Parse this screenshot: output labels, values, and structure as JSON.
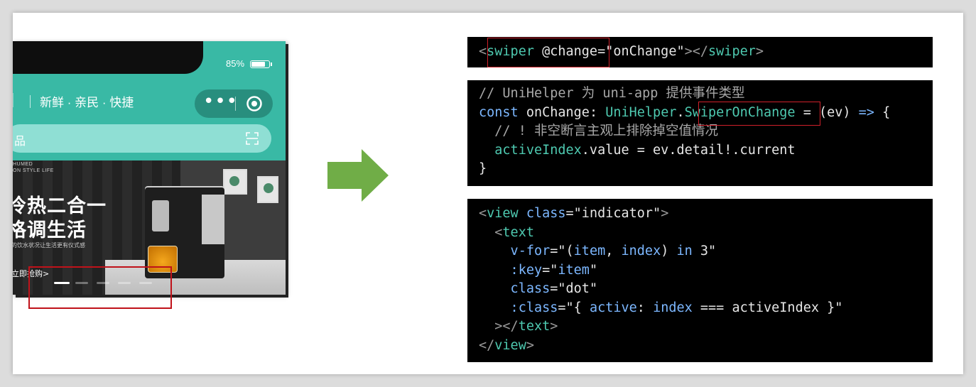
{
  "phone": {
    "battery_percent": "85%",
    "battery_level": 0.85,
    "logo_fragment": "l",
    "tagline": "新鲜 · 亲民 · 快捷",
    "menu_dots": "•••",
    "search_fragment": "品",
    "banner": {
      "brand_line1": "HUMED",
      "brand_line2": "ON STYLE LIFE",
      "headline1": "冷热二合一",
      "headline2": "格调生活",
      "small_line": "的饮水状况让生活更有仪式感",
      "buy_link": "立即抢购>"
    },
    "indicators": {
      "count": 5,
      "active_index": 0
    }
  },
  "code_blocks": {
    "block1": {
      "tokens": [
        "<",
        "swiper",
        " @change",
        "=",
        "\"onChange\"",
        "></",
        "swiper",
        ">"
      ]
    },
    "block2": {
      "line1": "// UniHelper 为 uni-app 提供事件类型",
      "line2_tokens": [
        "const",
        " onChange",
        ": ",
        "UniHelper",
        ".",
        "SwiperOnChange",
        " = (ev) ",
        "=>",
        " {"
      ],
      "line3": "  // ! 非空断言主观上排除掉空值情况",
      "line4_tokens": [
        "  activeIndex",
        ".value = ev.detail!.current"
      ],
      "line5": "}"
    },
    "block3": {
      "line1_tokens": [
        "<",
        "view",
        " class",
        "=",
        "\"indicator\"",
        ">"
      ],
      "line2_tokens": [
        "  <",
        "text"
      ],
      "line3_tokens": [
        "    v-for",
        "=\"(",
        "item",
        ", ",
        "index",
        ") ",
        "in",
        " 3\""
      ],
      "line4_tokens": [
        "    :key",
        "=\"",
        "item",
        "\""
      ],
      "line5_tokens": [
        "    class",
        "=",
        "\"dot\""
      ],
      "line6_tokens": [
        "    :class",
        "=\"{ ",
        "active",
        ": ",
        "index",
        " === ",
        "activeIndex",
        " }\""
      ],
      "line7_tokens": [
        "  ></",
        "text",
        ">"
      ],
      "line8_tokens": [
        "</",
        "view",
        ">"
      ]
    }
  },
  "colors": {
    "tag_teal": "#4ec9b0",
    "keyword_blue": "#7cb7ff",
    "highlight_red": "#d0202a",
    "arrow_green": "#70ad47",
    "header_teal": "#39b9a5"
  }
}
